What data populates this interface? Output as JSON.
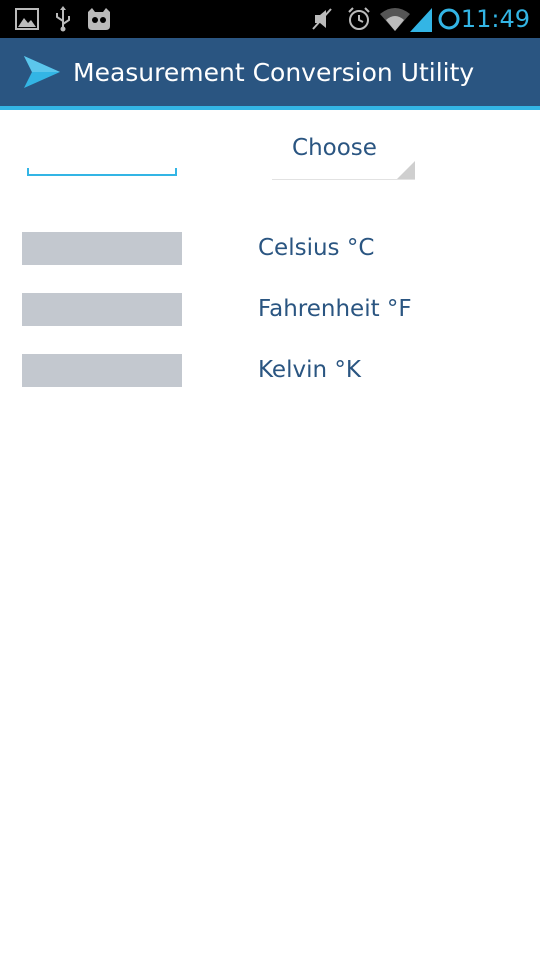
{
  "status_bar": {
    "time": "11:49",
    "icons": [
      "picture-icon",
      "usb-icon",
      "cyanogen-mascot-icon",
      "mute-icon",
      "alarm-icon",
      "wifi-icon",
      "signal-icon",
      "sync-ring-icon"
    ],
    "accent_color": "#33b5e5"
  },
  "action_bar": {
    "title": "Measurement Conversion Utility",
    "background_color": "#2a5581",
    "icon": "send-arrow-icon"
  },
  "input": {
    "value": "",
    "placeholder": ""
  },
  "spinner": {
    "selected": "Choose"
  },
  "results": [
    {
      "value": "",
      "unit": "Celsius °C"
    },
    {
      "value": "",
      "unit": "Fahrenheit °F"
    },
    {
      "value": "",
      "unit": "Kelvin °K"
    }
  ]
}
